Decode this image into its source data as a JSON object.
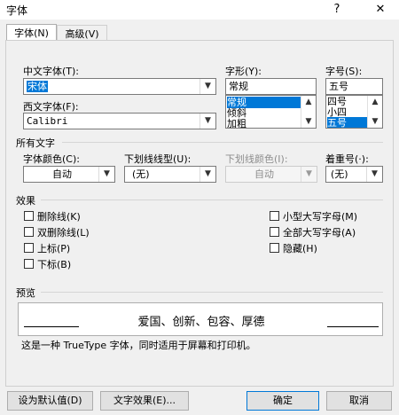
{
  "window": {
    "title": "字体",
    "help_label": "?",
    "close_label": "✕"
  },
  "tabs": [
    {
      "label": "字体(N)"
    },
    {
      "label": "高级(V)"
    }
  ],
  "font": {
    "chinese_label": "中文字体(T):",
    "chinese_value": "宋体",
    "western_label": "西文字体(F):",
    "western_value": "Calibri",
    "style_label": "字形(Y):",
    "style_value": "常规",
    "style_options": [
      "常规",
      "倾斜",
      "加粗"
    ],
    "size_label": "字号(S):",
    "size_value": "五号",
    "size_options": [
      "四号",
      "小四",
      "五号"
    ]
  },
  "all_text": {
    "header": "所有文字",
    "color_label": "字体颜色(C):",
    "color_value": "自动",
    "underline_style_label": "下划线线型(U):",
    "underline_style_value": "(无)",
    "underline_color_label": "下划线颜色(I):",
    "underline_color_value": "自动",
    "emphasis_label": "着重号(·):",
    "emphasis_value": "(无)"
  },
  "effects": {
    "header": "效果",
    "left": [
      {
        "label": "删除线(K)"
      },
      {
        "label": "双删除线(L)"
      },
      {
        "label": "上标(P)"
      },
      {
        "label": "下标(B)"
      }
    ],
    "right": [
      {
        "label": "小型大写字母(M)"
      },
      {
        "label": "全部大写字母(A)"
      },
      {
        "label": "隐藏(H)"
      }
    ]
  },
  "preview": {
    "header": "预览",
    "sample_text": "爱国、创新、包容、厚德",
    "note": "这是一种 TrueType 字体，同时适用于屏幕和打印机。"
  },
  "buttons": {
    "set_default": "设为默认值(D)",
    "text_effects": "文字效果(E)...",
    "ok": "确定",
    "cancel": "取消"
  }
}
